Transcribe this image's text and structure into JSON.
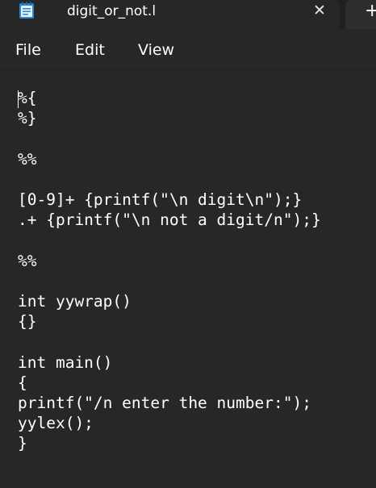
{
  "window": {
    "tab_title": "digit_or_not.l",
    "close_symbol": "✕",
    "new_tab_symbol": "+",
    "icon": "notepad-icon"
  },
  "menu": {
    "file": "File",
    "edit": "Edit",
    "view": "View"
  },
  "editor": {
    "content": "%{\n%}\n\n%%\n\n[0-9]+ {printf(\"\\n digit\\n\");}\n.+ {printf(\"\\n not a digit/n\");}\n\n%%\n\nint yywrap()\n{}\n\nint main()\n{\nprintf(\"/n enter the number:\");\nyylex();\n}"
  },
  "colors": {
    "background": "#272727",
    "tabstrip": "#202020",
    "text": "#ffffff",
    "icon_blue": "#2b88d8"
  }
}
